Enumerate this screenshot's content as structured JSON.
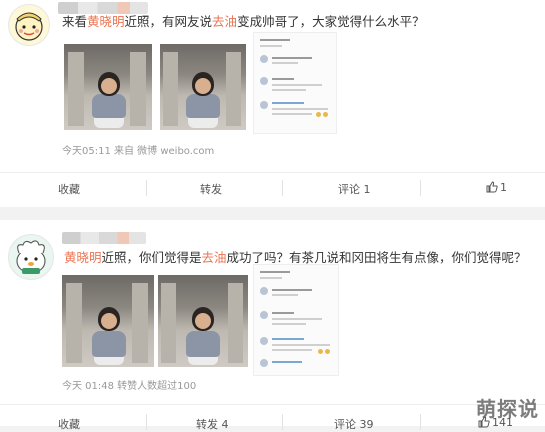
{
  "posts": [
    {
      "text_parts": [
        "来看",
        "黄晓明",
        "近照，有网友说",
        "去油",
        "变成帅哥了，大家觉得什么水平？"
      ],
      "meta": "今天05:11  来自 微博 weibo.com",
      "actions": {
        "collect": "收藏",
        "repost": "转发",
        "comment": "评论 1",
        "like": "1"
      }
    },
    {
      "text_parts": [
        "黄晓明",
        "近照，你们觉得是",
        "去油",
        "成功了吗？有茶几说和冈田将生有点像，你们觉得呢？"
      ],
      "meta": "今天 01:48 转赞人数超过100",
      "actions": {
        "collect": "收藏",
        "repost": "转发 4",
        "comment": "评论 39",
        "like": "141"
      }
    }
  ],
  "watermark": "萌探说",
  "colors": {
    "highlight": "#eb7350",
    "meta": "#999999",
    "background": "#f2f2f2"
  }
}
